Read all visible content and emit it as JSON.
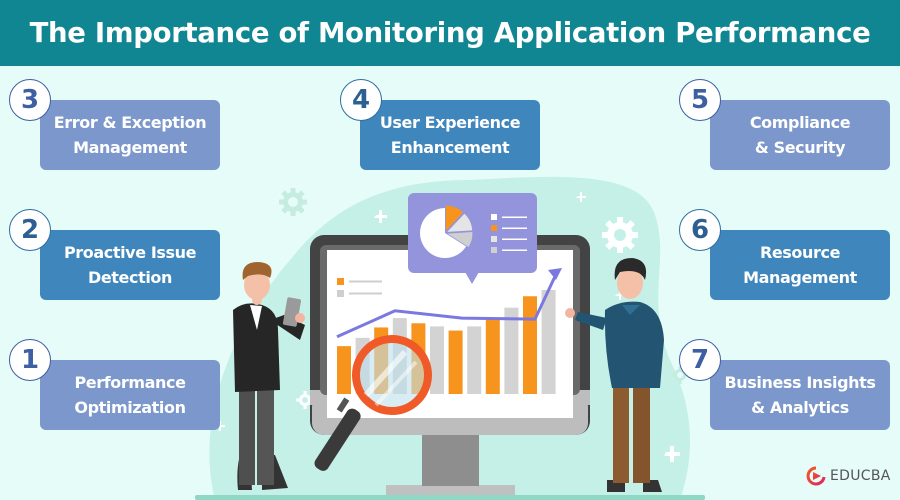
{
  "header": {
    "title": "The Importance of Monitoring Application Performance"
  },
  "items": [
    {
      "number": "1",
      "label_line1": "Performance",
      "label_line2": "Optimization"
    },
    {
      "number": "2",
      "label_line1": "Proactive Issue",
      "label_line2": "Detection"
    },
    {
      "number": "3",
      "label_line1": "Error &  Exception",
      "label_line2": "Management"
    },
    {
      "number": "4",
      "label_line1": "User Experience",
      "label_line2": "Enhancement"
    },
    {
      "number": "5",
      "label_line1": "Compliance",
      "label_line2": "& Security"
    },
    {
      "number": "6",
      "label_line1": "Resource",
      "label_line2": "Management"
    },
    {
      "number": "7",
      "label_line1": "Business Insights",
      "label_line2": "& Analytics"
    }
  ],
  "colors": {
    "header_bg": "#108692",
    "card_lavender": "#7b97cb",
    "card_blue": "#3f86bd",
    "bar_orange": "#f7941d",
    "bar_gray": "#d3d3d3",
    "trend_line": "#7b78e0",
    "magnifier": "#f05a28",
    "background": "#e6fcf8"
  },
  "illustration": {
    "monitor_bars": [
      {
        "series": "orange",
        "relative_height": 0.46
      },
      {
        "series": "gray",
        "relative_height": 0.54
      },
      {
        "series": "orange",
        "relative_height": 0.64
      },
      {
        "series": "gray",
        "relative_height": 0.73
      },
      {
        "series": "orange",
        "relative_height": 0.68
      },
      {
        "series": "gray",
        "relative_height": 0.65
      },
      {
        "series": "orange",
        "relative_height": 0.61
      },
      {
        "series": "gray",
        "relative_height": 0.65
      },
      {
        "series": "orange",
        "relative_height": 0.73
      },
      {
        "series": "gray",
        "relative_height": 0.83
      },
      {
        "series": "orange",
        "relative_height": 0.94
      },
      {
        "series": "gray",
        "relative_height": 1.0
      }
    ],
    "trend_points": [
      0.55,
      0.8,
      0.73,
      0.72,
      1.05
    ],
    "pie_slices": [
      {
        "color": "#ffffff",
        "fraction": 0.66
      },
      {
        "color": "#f7941d",
        "fraction": 0.12
      },
      {
        "color": "#e5e5e5",
        "fraction": 0.12
      },
      {
        "color": "#cfcfcf",
        "fraction": 0.1
      }
    ],
    "legend_swatches": [
      "#ffffff",
      "#f7941d",
      "#e5e5e5",
      "#cfcfcf"
    ]
  },
  "logo": {
    "text": "EDUCBA"
  }
}
